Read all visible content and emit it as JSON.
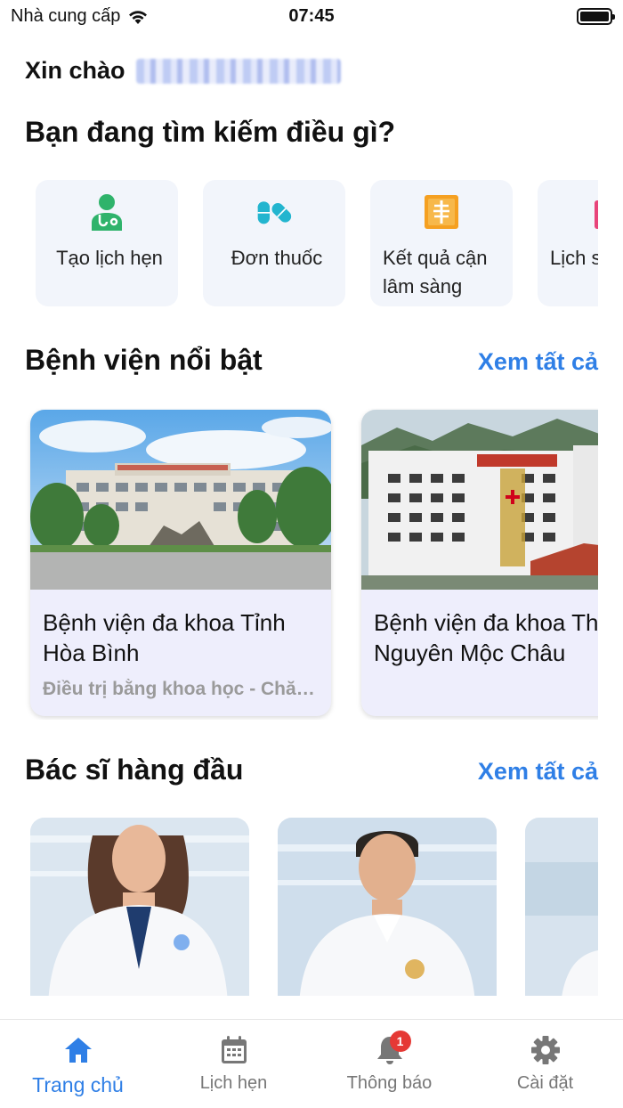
{
  "status_bar": {
    "carrier": "Nhà cung cấp",
    "time": "07:45"
  },
  "greeting": {
    "label": "Xin chào"
  },
  "search_section": {
    "title": "Bạn đang tìm kiếm điều gì?"
  },
  "quick_actions": [
    {
      "label": "Tạo lịch hẹn",
      "icon": "doctor-icon"
    },
    {
      "label": "Đơn thuốc",
      "icon": "pill-icon"
    },
    {
      "label": "Kết quả cận lâm sàng",
      "icon": "xray-icon"
    },
    {
      "label": "Lịch sử khám",
      "icon": "history-icon"
    }
  ],
  "hospitals_section": {
    "title": "Bệnh viện nổi bật",
    "see_all": "Xem tất cả"
  },
  "hospitals": [
    {
      "name_line1": "Bệnh viện đa khoa Tỉnh",
      "name_line2": "Hòa Bình",
      "description": "Điều trị bằng khoa học - Chăm sóc bằng y đức"
    },
    {
      "name_line1": "Bệnh viện đa khoa Thảo",
      "name_line2": "Nguyên Mộc Châu",
      "description": ""
    }
  ],
  "doctors_section": {
    "title": "Bác sĩ hàng đầu",
    "see_all": "Xem tất cả"
  },
  "tabs": [
    {
      "label": "Trang chủ",
      "icon": "home-icon",
      "active": true
    },
    {
      "label": "Lịch hẹn",
      "icon": "calendar-icon",
      "active": false
    },
    {
      "label": "Thông báo",
      "icon": "bell-icon",
      "active": false,
      "badge": "1"
    },
    {
      "label": "Cài đặt",
      "icon": "gear-icon",
      "active": false
    }
  ],
  "colors": {
    "accent": "#2f7fe6",
    "card_bg": "#f2f5fb",
    "hospital_card_bg": "#eeeefc",
    "icon_green": "#2fb36b",
    "icon_teal": "#23b5cf",
    "icon_orange": "#f5a021",
    "badge_red": "#e53935"
  }
}
